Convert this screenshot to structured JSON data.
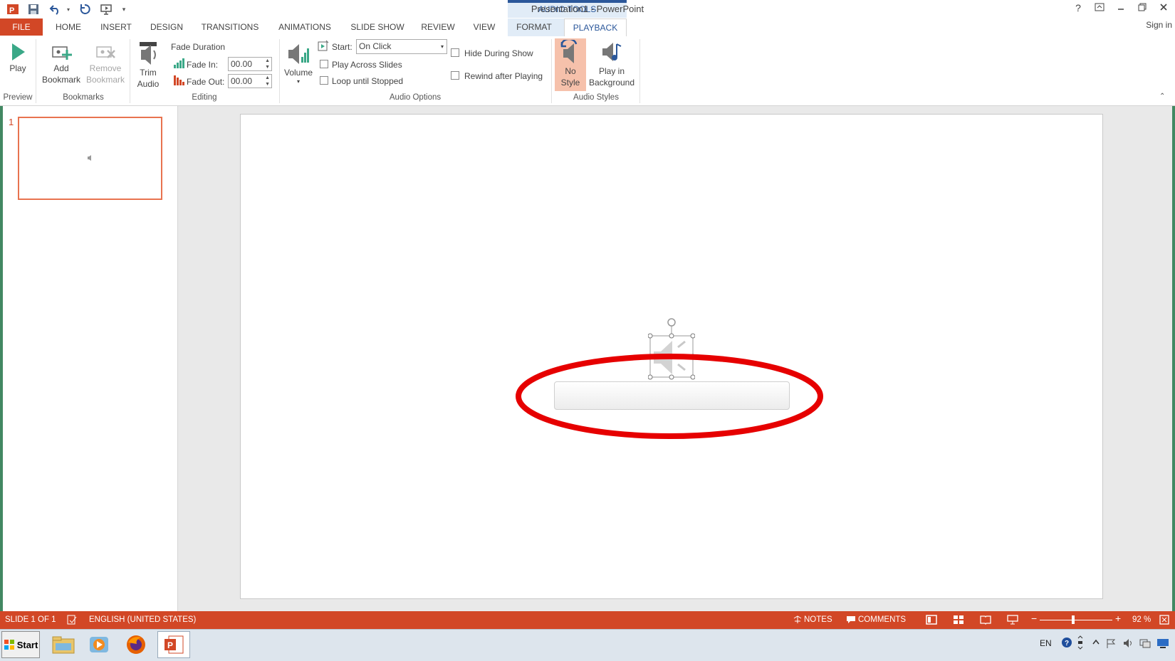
{
  "window": {
    "title": "Presentation1 - PowerPoint",
    "context_group": "AUDIO TOOLS",
    "help": "?",
    "sign_in": "Sign in"
  },
  "tabs": [
    {
      "label": "FILE"
    },
    {
      "label": "HOME"
    },
    {
      "label": "INSERT"
    },
    {
      "label": "DESIGN"
    },
    {
      "label": "TRANSITIONS"
    },
    {
      "label": "ANIMATIONS"
    },
    {
      "label": "SLIDE SHOW"
    },
    {
      "label": "REVIEW"
    },
    {
      "label": "VIEW"
    },
    {
      "label": "FORMAT"
    },
    {
      "label": "PLAYBACK"
    }
  ],
  "ribbon": {
    "preview": {
      "play": "Play",
      "group": "Preview"
    },
    "bookmarks": {
      "add_1": "Add",
      "add_2": "Bookmark",
      "remove_1": "Remove",
      "remove_2": "Bookmark",
      "group": "Bookmarks"
    },
    "editing": {
      "trim_1": "Trim",
      "trim_2": "Audio",
      "fade_duration": "Fade Duration",
      "fade_in_label": "Fade In:",
      "fade_in_value": "00.00",
      "fade_out_label": "Fade Out:",
      "fade_out_value": "00.00",
      "group": "Editing"
    },
    "audio_options": {
      "volume": "Volume",
      "start_label": "Start:",
      "start_value": "On Click",
      "play_across": "Play Across Slides",
      "loop": "Loop until Stopped",
      "hide": "Hide During Show",
      "rewind": "Rewind after Playing",
      "group": "Audio Options"
    },
    "audio_styles": {
      "no_style_1": "No",
      "no_style_2": "Style",
      "bg_1": "Play in",
      "bg_2": "Background",
      "group": "Audio Styles"
    }
  },
  "slides_panel": {
    "slide_number": "1"
  },
  "status": {
    "slide": "SLIDE 1 OF 1",
    "language": "ENGLISH (UNITED STATES)",
    "notes": "NOTES",
    "comments": "COMMENTS",
    "zoom": "92 %"
  },
  "taskbar": {
    "start": "Start",
    "lang": "EN"
  },
  "colors": {
    "accent": "#d24726",
    "playback_blue": "#2b579a",
    "highlight_ring": "#e60000"
  }
}
